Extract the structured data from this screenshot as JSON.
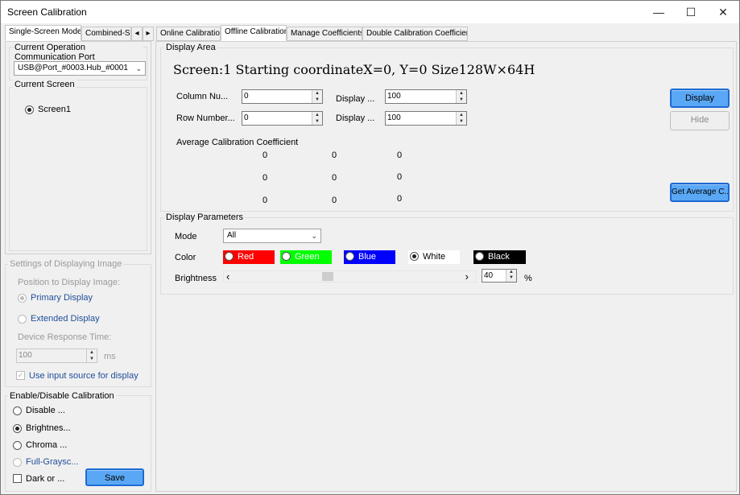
{
  "window": {
    "title": "Screen Calibration",
    "minimize": "—",
    "maximize": "☐",
    "close": "✕"
  },
  "left": {
    "tabs": [
      {
        "label": "Single-Screen Mode"
      },
      {
        "label": "Combined-Sc"
      }
    ],
    "tab_scroll_left": "◂",
    "tab_scroll_right": "▸",
    "comm_port": {
      "label": "Current Operation Communication Port",
      "value": "USB@Port_#0003.Hub_#0001"
    },
    "current_screen": {
      "label": "Current Screen",
      "option": "Screen1"
    },
    "display_settings": {
      "label": "Settings of Displaying Image",
      "position_label": "Position to Display Image:",
      "primary": "Primary Display",
      "extended": "Extended Display",
      "response_label": "Device Response Time:",
      "response_value": "100",
      "response_unit": "ms",
      "use_input_source": "Use input source for display"
    },
    "calibration": {
      "label": "Enable/Disable Calibration",
      "disable": "Disable ...",
      "brightness": "Brightnes...",
      "chroma": "Chroma ...",
      "full_gray": "Full-Graysc...",
      "dark": "Dark or ...",
      "save": "Save"
    }
  },
  "right": {
    "tabs": [
      {
        "label": "Online Calibration"
      },
      {
        "label": "Offline Calibration"
      },
      {
        "label": "Manage Coefficients"
      },
      {
        "label": "Double Calibration Coefficients"
      }
    ],
    "display_area": {
      "label": "Display Area",
      "info": "Screen:1  Starting coordinateX=0, Y=0   Size128W×64H",
      "column_label": "Column Nu...",
      "column_value": "0",
      "row_label": "Row Number...",
      "row_value": "0",
      "display1_label": "Display ...",
      "display1_value": "100",
      "display2_label": "Display ...",
      "display2_value": "100",
      "display_button": "Display",
      "hide_button": "Hide",
      "avg_label": "Average Calibration Coefficient",
      "avg_rows": [
        [
          "0",
          "0",
          "0"
        ],
        [
          "0",
          "0",
          "0"
        ],
        [
          "0",
          "0",
          "0"
        ]
      ],
      "get_average_button": "Get Average C..."
    },
    "display_params": {
      "label": "Display Parameters",
      "mode_label": "Mode",
      "mode_value": "All",
      "color_label": "Color",
      "colors": {
        "red": {
          "label": "Red",
          "bg": "#ff0000",
          "fg": "#ffffff"
        },
        "green": {
          "label": "Green",
          "bg": "#00ff00",
          "fg": "#ffffff"
        },
        "blue": {
          "label": "Blue",
          "bg": "#0000ff",
          "fg": "#ffffff"
        },
        "white": {
          "label": "White",
          "bg": "#ffffff",
          "fg": "#000000"
        },
        "black": {
          "label": "Black",
          "bg": "#000000",
          "fg": "#ffffff"
        }
      },
      "selected_color": "White",
      "brightness_label": "Brightness",
      "slider_left": "‹",
      "slider_right": "›",
      "brightness_value": "40",
      "brightness_unit": "%"
    }
  }
}
